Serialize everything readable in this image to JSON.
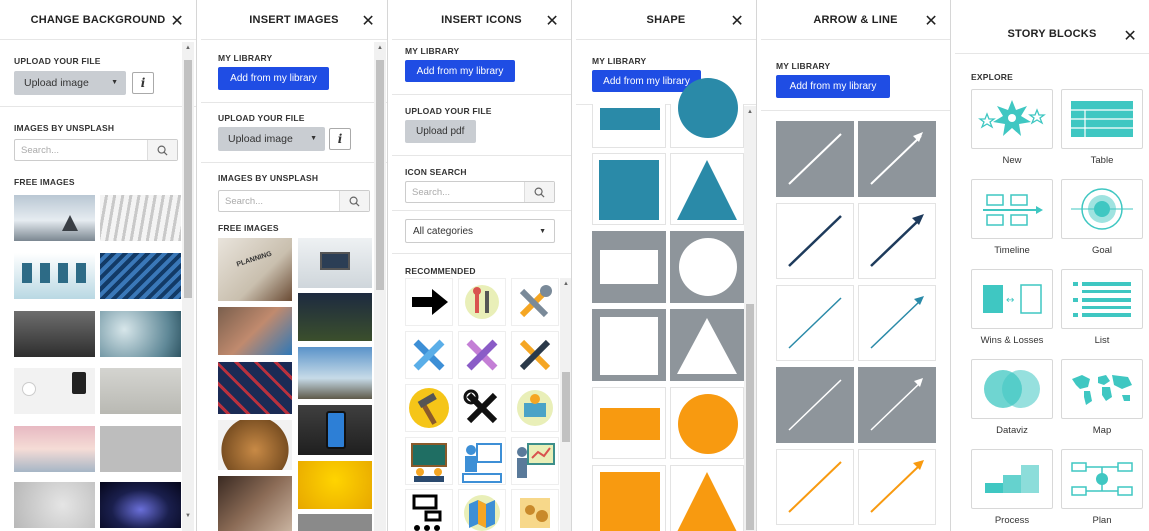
{
  "close_glyph": "✕",
  "change_background": {
    "title": "CHANGE BACKGROUND",
    "upload_section": "UPLOAD YOUR FILE",
    "upload_button": "Upload image",
    "info_button": "i",
    "unsplash_section": "IMAGES BY UNSPLASH",
    "search_placeholder": "Search...",
    "free_images_section": "FREE IMAGES"
  },
  "insert_images": {
    "title": "INSERT IMAGES",
    "library_section": "MY LIBRARY",
    "library_button": "Add from my library",
    "upload_section": "UPLOAD YOUR FILE",
    "upload_button": "Upload image",
    "info_button": "i",
    "unsplash_section": "IMAGES BY UNSPLASH",
    "search_placeholder": "Search...",
    "free_images_section": "FREE IMAGES",
    "planning_text": "PLANNING"
  },
  "insert_icons": {
    "title": "INSERT ICONS",
    "library_section": "MY LIBRARY",
    "library_button": "Add from my library",
    "upload_section": "UPLOAD YOUR FILE",
    "upload_button": "Upload pdf",
    "icon_search_section": "ICON SEARCH",
    "search_placeholder": "Search...",
    "category_select": "All categories",
    "recommended_section": "RECOMMENDED",
    "icons": [
      "arrow-right-icon",
      "tools-circle-icon",
      "wrench-icon",
      "wrench-blue-icon",
      "wrench-purple-icon",
      "tools-cross-icon",
      "hammer-icon",
      "tools-dark-icon",
      "worker-icon",
      "classroom-icon",
      "presenter-icon",
      "teacher-icon",
      "sitemap-icon",
      "map-icon",
      "world-map-icon"
    ]
  },
  "shape": {
    "title": "SHAPE",
    "library_section": "MY LIBRARY",
    "library_button": "Add from my library",
    "colors": {
      "teal": "#2a8aa8",
      "grey": "#8e959b",
      "orange": "#f89a10"
    }
  },
  "arrow_line": {
    "title": "ARROW & LINE",
    "library_section": "MY LIBRARY",
    "library_button": "Add from my library",
    "colors": {
      "grey": "#8e959b",
      "navy": "#1e3b5c",
      "teal": "#2a8aa8",
      "orange": "#f89a10"
    }
  },
  "story_blocks": {
    "title": "STORY BLOCKS",
    "explore_section": "EXPLORE",
    "blocks": [
      "New",
      "Table",
      "Timeline",
      "Goal",
      "Wins & Losses",
      "List",
      "Dataviz",
      "Map",
      "Process",
      "Plan"
    ],
    "accent": "#3fc7c2"
  }
}
